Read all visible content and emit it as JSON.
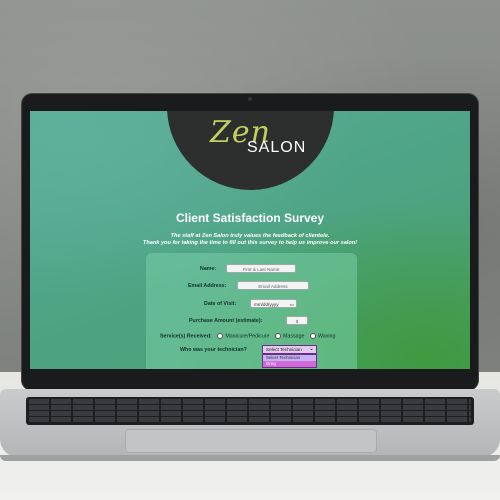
{
  "logo": {
    "script": "Zen",
    "word": "SALON"
  },
  "survey": {
    "title": "Client Satisfaction Survey",
    "intro_line1": "The staff at Zen Salon truly values the feedback of clientele.",
    "intro_line2": "Thank you for taking the time to fill out this survey to help us improve our salon!"
  },
  "form": {
    "name_label": "Name:",
    "name_placeholder": "First & Last Name",
    "email_label": "Email Address:",
    "email_placeholder": "Email Address",
    "date_label": "Date of Visit:",
    "date_value": "mm/dd/yyyy",
    "amount_label": "Purchase Amount (estimate):",
    "amount_value": "$",
    "services_label": "Service(s) Received:",
    "services": [
      "Manicure/Pedicure",
      "Massage",
      "Waxing"
    ],
    "technician_label": "Who was your technician?",
    "technician_selected": "Select Technician",
    "technician_options": [
      "Select Technician",
      "Greg"
    ]
  },
  "colors": {
    "accent_select": "#6a2c86",
    "dropdown_bg": "#d16ad8",
    "logo_script": "#c3cf5f"
  }
}
